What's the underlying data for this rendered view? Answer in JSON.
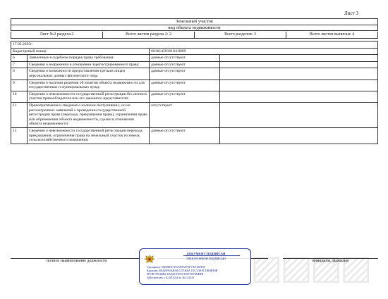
{
  "sheet_label": "Лист 3",
  "header": {
    "title": "Земельный участок",
    "subtitle": "вид объекта недвижимости"
  },
  "meta": {
    "sheet_section": "Лист №2 раздела 2",
    "total_sheets_section": "Всего листов раздела 2: 2",
    "total_sections": "Всего разделов: 3",
    "total_sheets_extract": "Всего листов выписки: 4"
  },
  "date": "17.02.2025г.",
  "cadastral": {
    "label": "Кадастровый номер:",
    "value": "66:06:4501018:10069"
  },
  "rows": [
    {
      "num": "6",
      "label": "Заявленные в судебном порядке права требования:",
      "value": "данные отсутствуют"
    },
    {
      "num": "7",
      "label": "Сведения о возражении в отношении зарегистрированного права:",
      "value": "данные отсутствуют"
    },
    {
      "num": "8",
      "label": "Сведения о возможности предоставления третьим лицам персональных данных физического лица",
      "value": "данные отсутствуют"
    },
    {
      "num": "9",
      "label": "Сведения о наличии решения об изъятии объекта недвижимости для государственных и муниципальных нужд:",
      "value": "данные отсутствуют"
    },
    {
      "num": "10",
      "label": "Сведения о невозможности государственной регистрации без личного участия правообладателя или его законного представителя:",
      "value": "данные отсутствуют"
    },
    {
      "num": "11",
      "label": "Правопритязания и сведения о наличии поступивших, но не рассмотренных заявлений о проведении государственной регистрации права (перехода, прекращения права), ограничения права или обременения объекта недвижимости, сделки в отношении объекта недвижимости:",
      "value": "отсутствуют"
    },
    {
      "num": "12",
      "label": "Сведения о невозможности государственной регистрации перехода, прекращения, ограничения права на земельный участок из земель сельскохозяйственного назначения:",
      "value": "данные отсутствуют"
    }
  ],
  "footer": {
    "position_label": "полное наименование должности",
    "name_label": "инициалы, фамилия"
  },
  "stamp": {
    "title": "ДОКУМЕНТ ПОДПИСАН",
    "subtitle": "ЭЛЕКТРОННОЙ ПОДПИСЬЮ",
    "cert": "Сертификат: 00D9EDC1EAAE9A07EF17D1E6FE90",
    "owner1": "Владелец: ФЕДЕРАЛЬНАЯ СЛУЖБА ГОСУДАРСТВЕННОЙ",
    "owner2": "РЕГИСТРАЦИИ, КАДАСТРА И КАРТОГРАФИИ",
    "valid": "Действителен: с 02.08.2024 по 26.10.2025"
  },
  "colors": {
    "stamp": "#1b2a8f"
  }
}
